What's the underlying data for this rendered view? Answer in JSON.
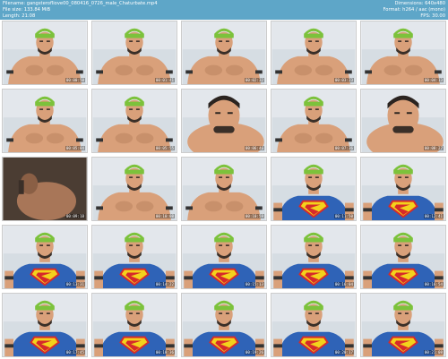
{
  "header": {
    "filename_label": "Filename:",
    "filename": "gangsterofliove00_080416_0726_male_Chaturbate.mp4",
    "filesize_label": "File size:",
    "filesize": "133.84 MiB",
    "length_label": "Length:",
    "length": "21:08",
    "dimensions_label": "Dimensions:",
    "dimensions": "640x480",
    "format_label": "Format:",
    "format": "h264 / aac (mono)",
    "fps_label": "FPS:",
    "fps": "30.00"
  },
  "colors": {
    "header_bg": "#5ea6c8",
    "cap_green": "#7cc23b",
    "shirt_blue": "#2f63b7",
    "logo_red": "#d62a2a",
    "logo_yellow": "#f3d21c"
  },
  "thumbnails": [
    {
      "time": "00:00:50",
      "type": "bare"
    },
    {
      "time": "00:01:41",
      "type": "bare"
    },
    {
      "time": "00:02:32",
      "type": "bare"
    },
    {
      "time": "00:03:23",
      "type": "bare"
    },
    {
      "time": "00:04:13",
      "type": "bare"
    },
    {
      "time": "00:05:04",
      "type": "bare"
    },
    {
      "time": "00:05:55",
      "type": "bare"
    },
    {
      "time": "00:06:46",
      "type": "closeup"
    },
    {
      "time": "00:07:36",
      "type": "bare"
    },
    {
      "time": "00:08:27",
      "type": "closeup"
    },
    {
      "time": "00:09:18",
      "type": "dark"
    },
    {
      "time": "00:10:08",
      "type": "bare"
    },
    {
      "time": "00:10:59",
      "type": "bare"
    },
    {
      "time": "00:11:50",
      "type": "shirt"
    },
    {
      "time": "00:12:41",
      "type": "shirt"
    },
    {
      "time": "00:13:31",
      "type": "shirt"
    },
    {
      "time": "00:14:22",
      "type": "shirt"
    },
    {
      "time": "00:15:13",
      "type": "shirt"
    },
    {
      "time": "00:16:04",
      "type": "shirt"
    },
    {
      "time": "00:16:54",
      "type": "shirt"
    },
    {
      "time": "00:17:45",
      "type": "shirt"
    },
    {
      "time": "00:18:36",
      "type": "shirt"
    },
    {
      "time": "00:19:26",
      "type": "shirt"
    },
    {
      "time": "00:20:17",
      "type": "shirt"
    },
    {
      "time": "00:21:08",
      "type": "shirt"
    }
  ]
}
